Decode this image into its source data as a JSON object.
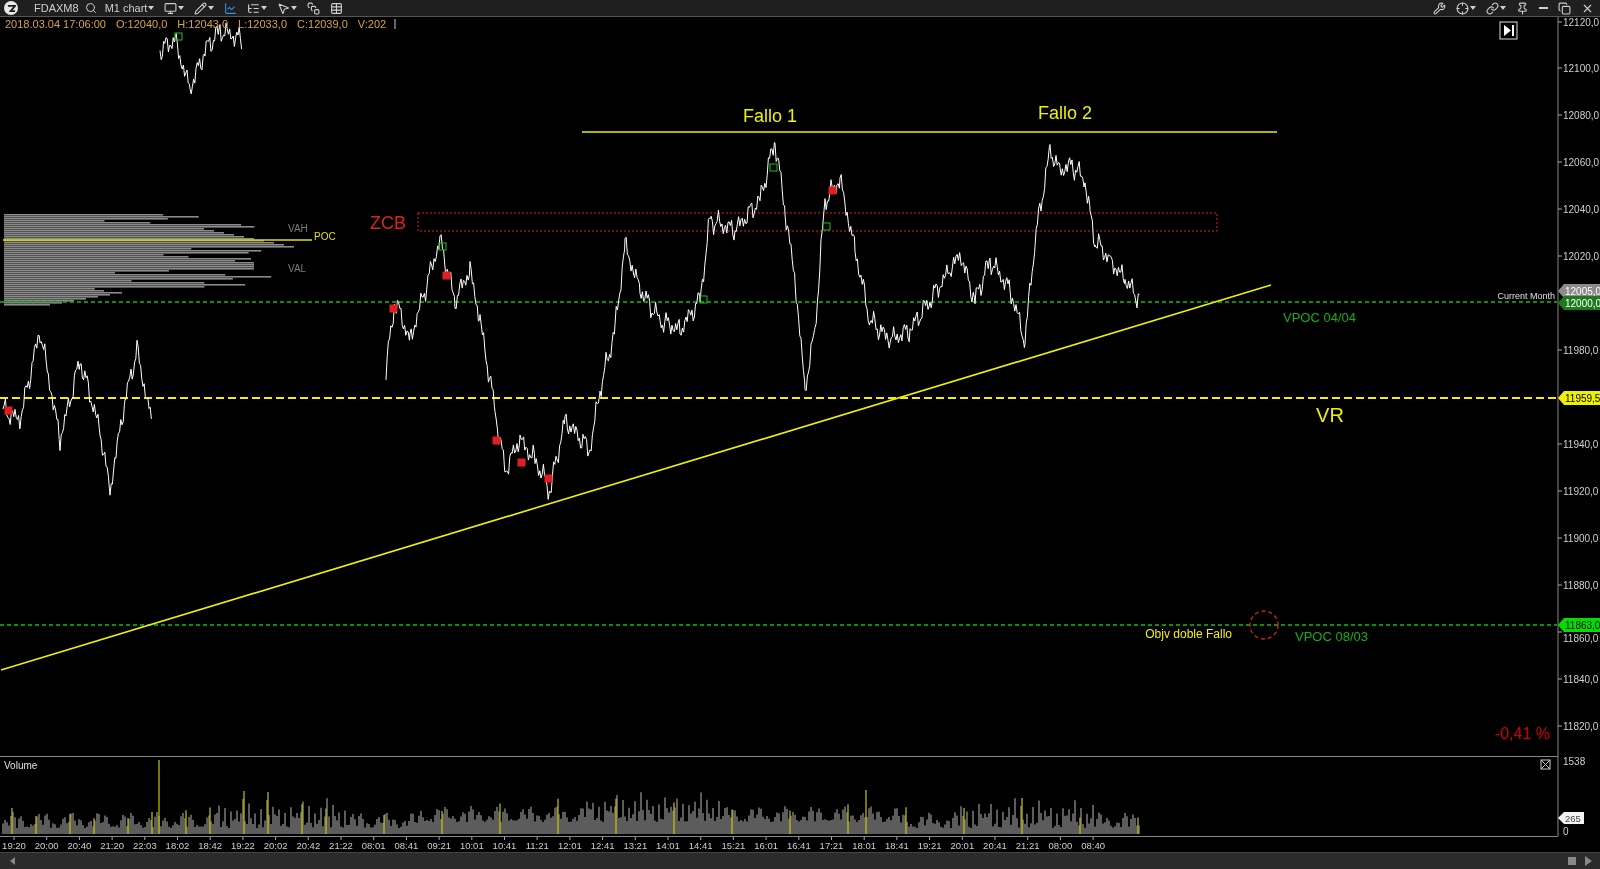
{
  "toolbar": {
    "symbol": "FDAXM8",
    "timeframe": "M1 chart",
    "tools": [
      {
        "kind": "display",
        "dropdown": true,
        "selected": false
      },
      {
        "kind": "draw",
        "dropdown": true,
        "selected": false
      },
      {
        "kind": "chart-type",
        "dropdown": false,
        "selected": true
      },
      {
        "kind": "indicators",
        "dropdown": true,
        "selected": false
      },
      {
        "kind": "cursor",
        "dropdown": true,
        "selected": false
      },
      {
        "kind": "window",
        "dropdown": false,
        "selected": false
      },
      {
        "kind": "grid",
        "dropdown": false,
        "selected": false
      }
    ],
    "window_controls": [
      {
        "kind": "tools",
        "dropdown": false
      },
      {
        "kind": "crosshair",
        "dropdown": true
      },
      {
        "kind": "link",
        "dropdown": true
      },
      {
        "kind": "pin",
        "dropdown": false
      },
      {
        "kind": "minimize",
        "dropdown": false
      },
      {
        "kind": "restore",
        "dropdown": false
      },
      {
        "kind": "close",
        "dropdown": false
      }
    ]
  },
  "bar_info": [
    "2018.03.04 17:06:00",
    "O:12040,0",
    "H:12043,0",
    "L:12033,0",
    "C:12039,0",
    "V:202"
  ],
  "price_axis": {
    "labels": [
      "12120,0",
      "12100,0",
      "12080,0",
      "12060,0",
      "12040,0",
      "12020,0",
      "11980,0",
      "11940,0",
      "11920,0",
      "11900,0",
      "11880,0",
      "11860,0",
      "11840,0",
      "11820,0"
    ],
    "session_label": "Current Month",
    "markers": [
      {
        "label": "12005,0",
        "color": "#8c8c8c"
      },
      {
        "label": "12000,0",
        "color": "#1c7c1c"
      },
      {
        "label": "11959,5",
        "color": "#f0f000"
      },
      {
        "label": "11863,0",
        "color": "#00e000"
      }
    ]
  },
  "volume_profile": {
    "labels": [
      {
        "text": "VAH",
        "color": "#7a7a7a"
      },
      {
        "text": "POC",
        "color": "#e0e000"
      },
      {
        "text": "VAL",
        "color": "#7a7a7a"
      }
    ]
  },
  "annotations": [
    {
      "text": "Fallo 1",
      "color": "#f0f000"
    },
    {
      "text": "Fallo 2",
      "color": "#f0f000"
    },
    {
      "text": "ZCB",
      "color": "#e02020"
    },
    {
      "text": "VPOC 04/04",
      "color": "#10b010"
    },
    {
      "text": "VR",
      "color": "#f0f000"
    },
    {
      "text": "Objv doble Fallo",
      "color": "#f0f000"
    },
    {
      "text": "VPOC 08/03",
      "color": "#10b010"
    },
    {
      "text": "-0,41 %",
      "color": "#d00000"
    }
  ],
  "volume_pane": {
    "title": "Volume",
    "axis_labels": [
      "1538",
      "0"
    ],
    "marker": "265"
  },
  "time_axis": [
    "19:20",
    "20:00",
    "20:40",
    "21:20",
    "22:03",
    "18:02",
    "18:42",
    "19:22",
    "20:02",
    "20:42",
    "21:22",
    "08:01",
    "08:41",
    "09:21",
    "10:01",
    "10:41",
    "11:21",
    "12:01",
    "12:41",
    "13:21",
    "14:01",
    "14:41",
    "15:21",
    "16:01",
    "16:41",
    "17:21",
    "18:01",
    "18:41",
    "19:21",
    "20:01",
    "20:41",
    "21:21",
    "08:00",
    "08:40"
  ]
}
